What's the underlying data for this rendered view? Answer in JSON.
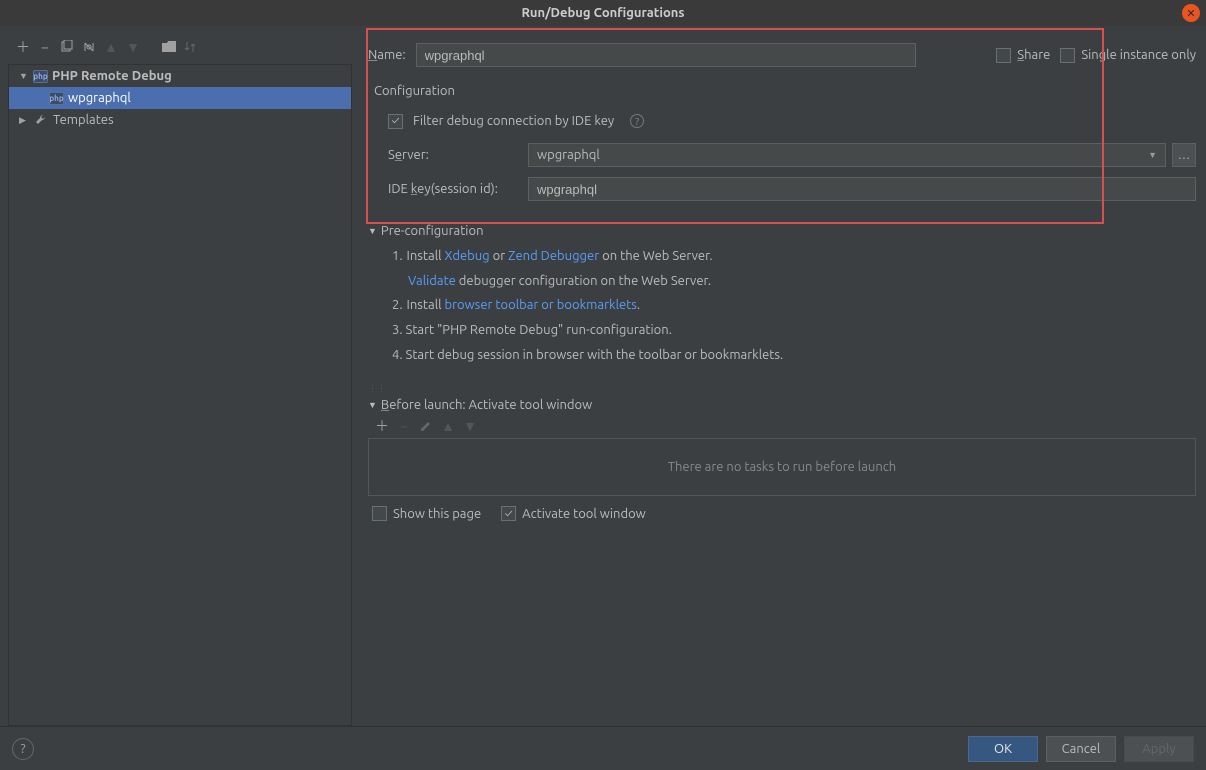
{
  "title": "Run/Debug Configurations",
  "tree": {
    "root1": "PHP Remote Debug",
    "child1": "wpgraphql",
    "root2": "Templates"
  },
  "form": {
    "name_label": "Name:",
    "name_value": "wpgraphql",
    "share_label": "Share",
    "single_label": "Single instance only",
    "config_header": "Configuration",
    "filter_label": "Filter debug connection by IDE key",
    "server_label": "Server:",
    "server_value": "wpgraphql",
    "idekey_label": "IDE key(session id):",
    "idekey_value": "wpgraphql"
  },
  "pre": {
    "header": "Pre-configuration",
    "l1a": "1.",
    "l1b": "Install ",
    "link_xdebug": "Xdebug",
    "l1c": "  or  ",
    "link_zend": "Zend Debugger",
    "l1d": " on the Web Server.",
    "link_validate": "Validate",
    "l1e": " debugger configuration on the Web Server.",
    "l2a": "2.",
    "l2b": "Install ",
    "link_toolbar": "browser toolbar or bookmarklets",
    "l2c": ".",
    "l3": "3. Start \"PHP Remote Debug\" run-configuration.",
    "l4": "4. Start debug session in browser with the toolbar or bookmarklets."
  },
  "before": {
    "header": "Before launch: Activate tool window",
    "empty": "There are no tasks to run before launch",
    "show_page": "Show this page",
    "activate": "Activate tool window"
  },
  "buttons": {
    "ok": "OK",
    "cancel": "Cancel",
    "apply": "Apply"
  }
}
